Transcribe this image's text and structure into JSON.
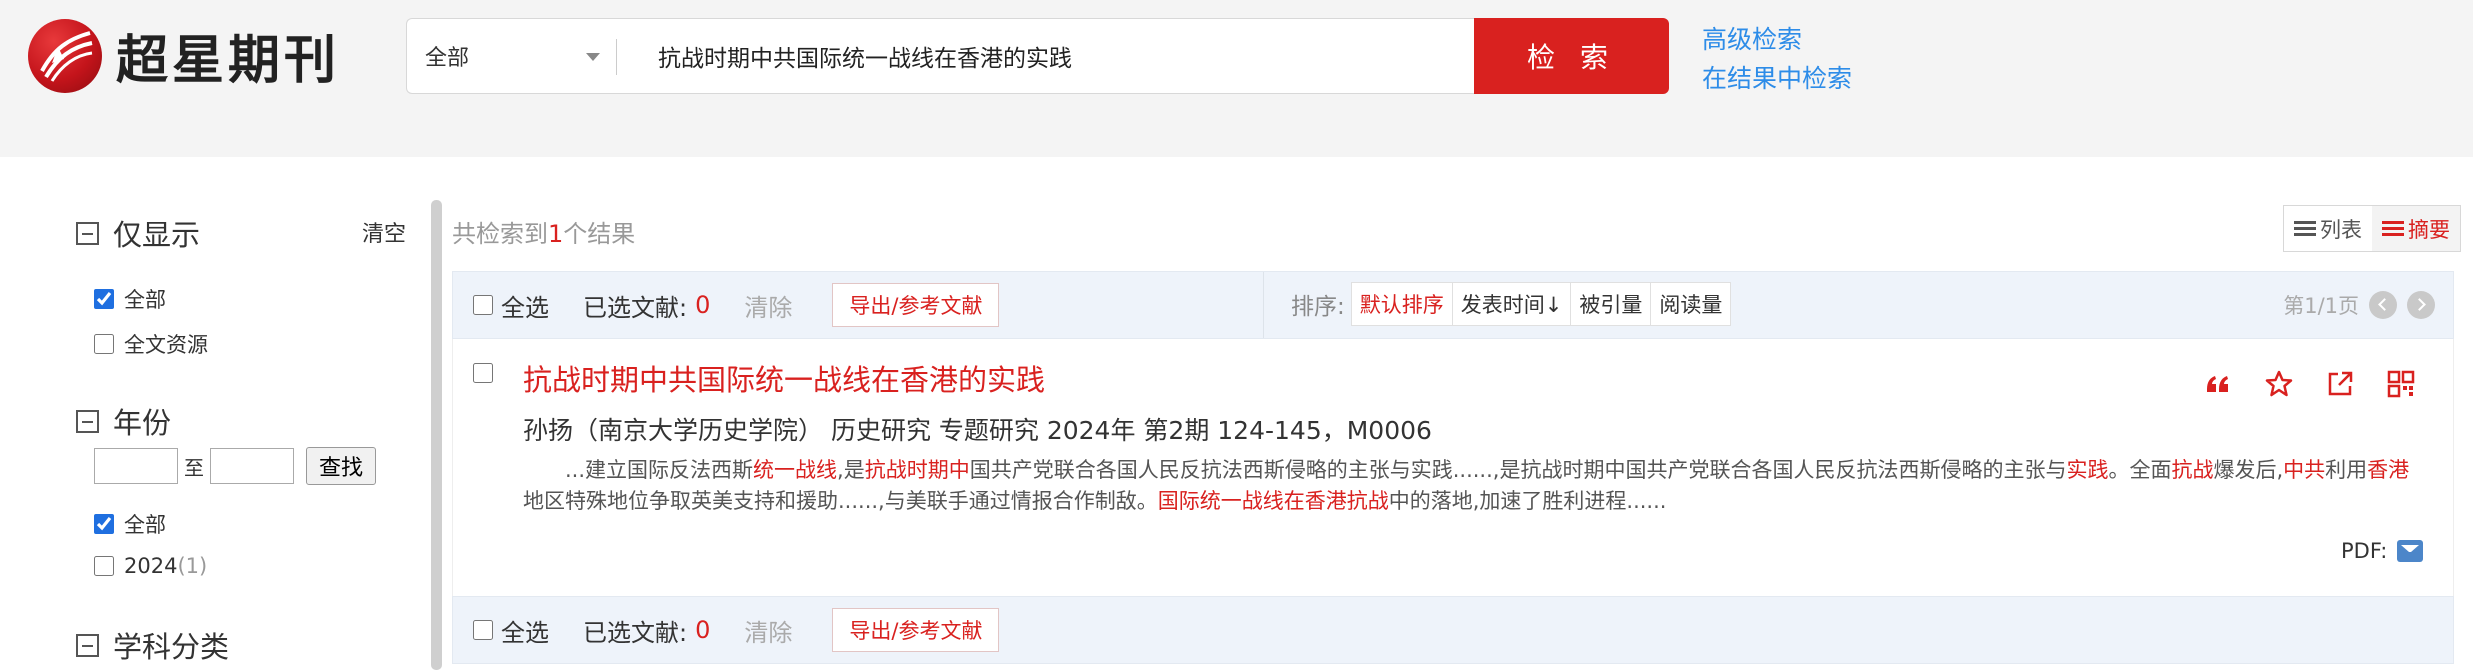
{
  "header": {
    "logo_text": "超星期刊",
    "search_scope": "全部",
    "search_query": "抗战时期中共国际统一战线在香港的实践",
    "search_button": "检 索",
    "advanced_search": "高级检索",
    "search_in_results": "在结果中检索"
  },
  "sidebar": {
    "only_show": {
      "title": "仅显示",
      "clear": "清空",
      "options": [
        {
          "label": "全部",
          "checked": true
        },
        {
          "label": "全文资源",
          "checked": false
        }
      ]
    },
    "year": {
      "title": "年份",
      "to_label": "至",
      "find_button": "查找",
      "options": [
        {
          "label": "全部",
          "checked": true
        },
        {
          "label": "2024",
          "count": "(1)",
          "checked": false
        }
      ]
    },
    "subject": {
      "title": "学科分类"
    }
  },
  "results": {
    "summary_prefix": "共检索到",
    "summary_count": "1",
    "summary_suffix": "个结果",
    "view_list": "列表",
    "view_abstract": "摘要"
  },
  "toolbar": {
    "select_all": "全选",
    "selected_label": "已选文献:",
    "selected_count": "0",
    "clear": "清除",
    "export": "导出/参考文献",
    "sort_label": "排序:",
    "sort_options": [
      "默认排序",
      "发表时间↓",
      "被引量",
      "阅读量"
    ],
    "page_info": "第1/1页"
  },
  "record": {
    "title": "抗战时期中共国际统一战线在香港的实践",
    "meta": "孙扬（南京大学历史学院） 历史研究 专题研究  2024年 第2期 124-145，M0006",
    "abstract_parts": [
      {
        "t": "...建立国际反法西斯",
        "hl": false
      },
      {
        "t": "统一战线",
        "hl": true
      },
      {
        "t": ",是",
        "hl": false
      },
      {
        "t": "抗战时期中",
        "hl": true
      },
      {
        "t": "国共产党联合各国人民反抗法西斯侵略的主张与实践......,是抗战时期中国共产党联合各国人民反抗法西斯侵略的主张与",
        "hl": false
      },
      {
        "t": "实践",
        "hl": true
      },
      {
        "t": "。全面",
        "hl": false
      },
      {
        "t": "抗战",
        "hl": true
      },
      {
        "t": "爆发后,",
        "hl": false
      },
      {
        "t": "中共",
        "hl": true
      },
      {
        "t": "利用",
        "hl": false
      },
      {
        "t": "香港",
        "hl": true
      },
      {
        "t": "地区特殊地位争取英美支持和援助......,与美联手通过情报合作制敌。",
        "hl": false
      },
      {
        "t": "国际统一战线在香港抗战",
        "hl": true
      },
      {
        "t": "中的落地,加速了胜利进程......",
        "hl": false
      }
    ],
    "pdf_label": "PDF:",
    "icons": [
      "quote-icon",
      "star-icon",
      "share-icon",
      "qrcode-icon"
    ]
  },
  "colors": {
    "accent": "#d9211f",
    "link": "#2d8ce8"
  }
}
